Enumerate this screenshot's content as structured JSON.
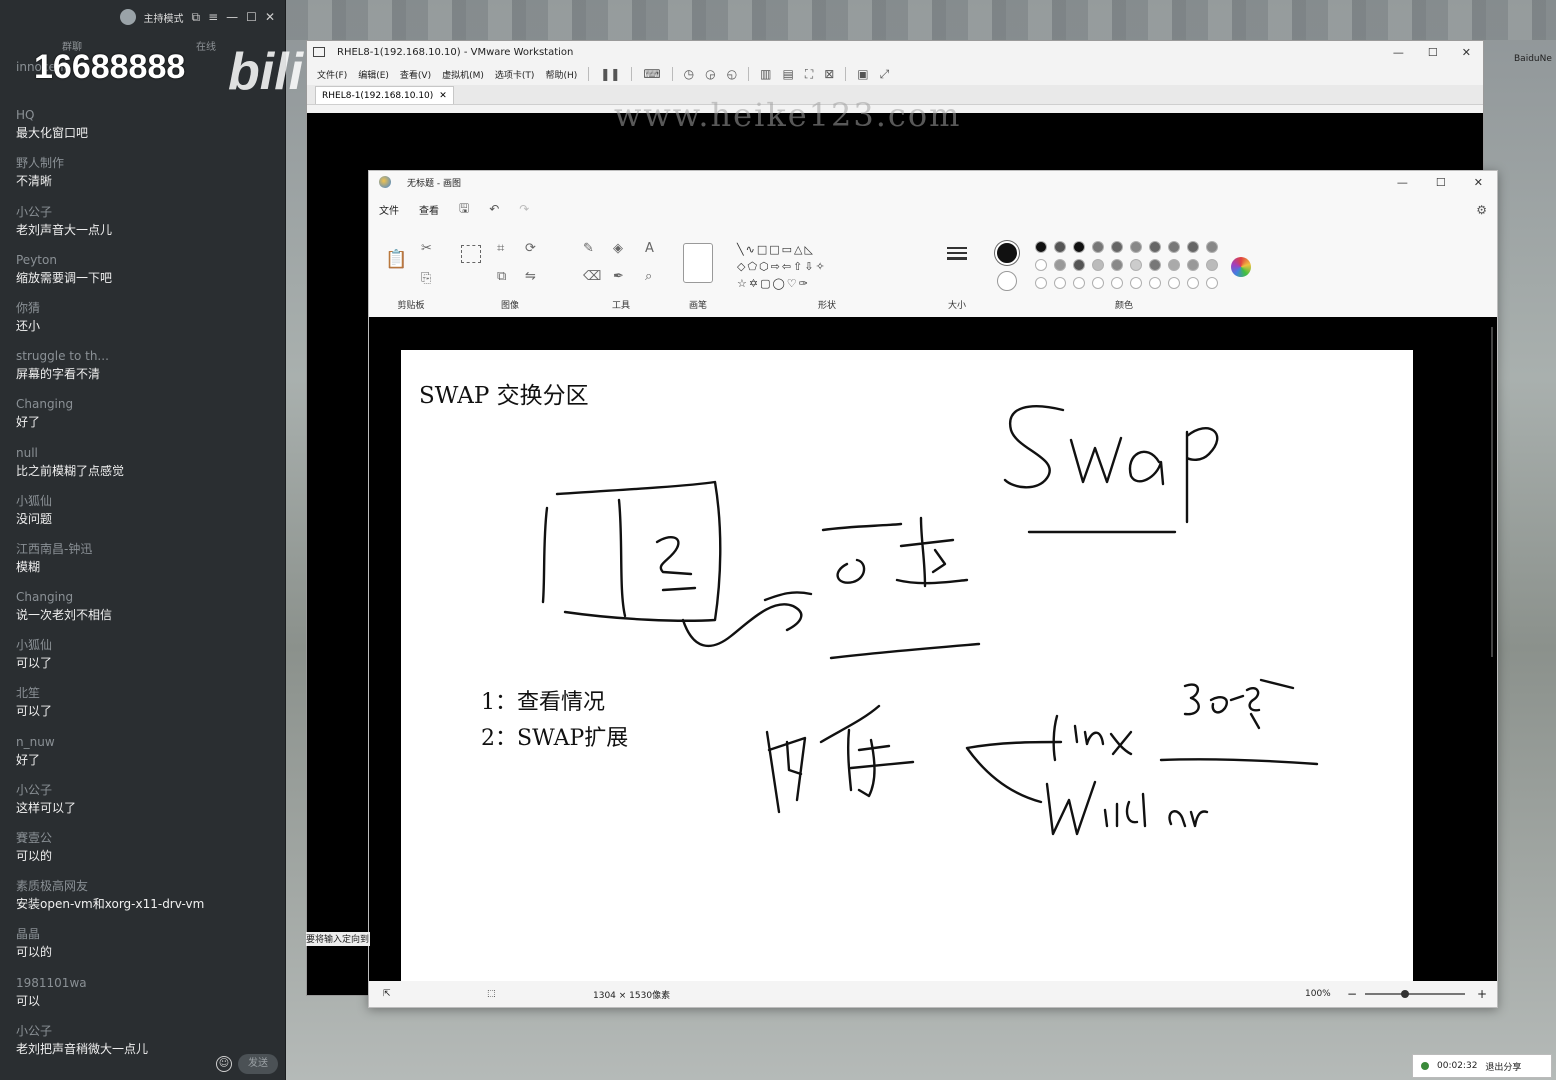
{
  "chat_panel": {
    "mode_label": "主持模式",
    "tabs": [
      "群聊",
      "在线"
    ],
    "overlay_number": "16688888",
    "overlay_logo": "bili",
    "messages": [
      {
        "user": "innocent",
        "text": ""
      },
      {
        "user": "HQ",
        "text": "最大化窗口吧"
      },
      {
        "user": "野人制作",
        "text": "不清晰"
      },
      {
        "user": "小公子",
        "text": "老刘声音大一点儿"
      },
      {
        "user": "Peyton",
        "text": "缩放需要调一下吧"
      },
      {
        "user": "你猜",
        "text": "还小"
      },
      {
        "user": "struggle to th...",
        "text": "屏幕的字看不清"
      },
      {
        "user": "Changing",
        "text": "好了"
      },
      {
        "user": "null",
        "text": "比之前模糊了点感觉"
      },
      {
        "user": "小狐仙",
        "text": "没问题"
      },
      {
        "user": "江西南昌-钟迅",
        "text": "模糊"
      },
      {
        "user": "Changing",
        "text": "说一次老刘不相信"
      },
      {
        "user": "小狐仙",
        "text": "可以了"
      },
      {
        "user": "北笙",
        "text": "可以了"
      },
      {
        "user": "n_nuw",
        "text": "好了"
      },
      {
        "user": "小公子",
        "text": "这样可以了"
      },
      {
        "user": "賽壹公",
        "text": "可以的"
      },
      {
        "user": "素质极高网友",
        "text": "安装open-vm和xorg-x11-drv-vm"
      },
      {
        "user": "晶晶",
        "text": "可以的"
      },
      {
        "user": "1981101wa",
        "text": "可以"
      },
      {
        "user": "小公子",
        "text": "老刘把声音稍微大一点儿"
      }
    ],
    "send_label": "发送"
  },
  "desktop": {
    "icon_label": "BaiduNe"
  },
  "vmware": {
    "title": "RHEL8-1(192.168.10.10) - VMware Workstation",
    "menu": [
      "文件(F)",
      "编辑(E)",
      "查看(V)",
      "虚拟机(M)",
      "选项卡(T)",
      "帮助(H)"
    ],
    "tab_label": "RHEL8-1(192.168.10.10)",
    "input_hint": "要将输入定向到"
  },
  "watermark": "www.heike123.com",
  "paint": {
    "title": "无标题 - 画图",
    "menu": [
      "文件",
      "查看"
    ],
    "groups": {
      "clipboard": "剪贴板",
      "image": "图像",
      "tools": "工具",
      "brushes": "画笔",
      "shapes": "形状",
      "size": "大小",
      "colors": "颜色"
    },
    "palette": [
      "#111111",
      "#555555",
      "#111111",
      "#777777",
      "#666666",
      "#888888",
      "#666666",
      "#777777",
      "#666666",
      "#888888",
      "#ffffff",
      "#999999",
      "#555555",
      "#bbbbbb",
      "#888888",
      "#cccccc",
      "#777777",
      "#aaaaaa",
      "#999999",
      "#bbbbbb",
      "#ffffff",
      "#ffffff",
      "#ffffff",
      "#ffffff",
      "#ffffff",
      "#ffffff",
      "#ffffff",
      "#ffffff",
      "#ffffff",
      "#ffffff"
    ],
    "canvas": {
      "heading": "SWAP 交换分区",
      "items": [
        "1：查看情况",
        "2：SWAP扩展"
      ],
      "handwriting": [
        "SWAP",
        "Linux",
        "Windows"
      ]
    },
    "status": {
      "canvas_size": "1304 × 1530像素",
      "zoom": "100%"
    }
  },
  "share_bar": {
    "timer": "00:02:32",
    "exit_label": "退出分享"
  }
}
